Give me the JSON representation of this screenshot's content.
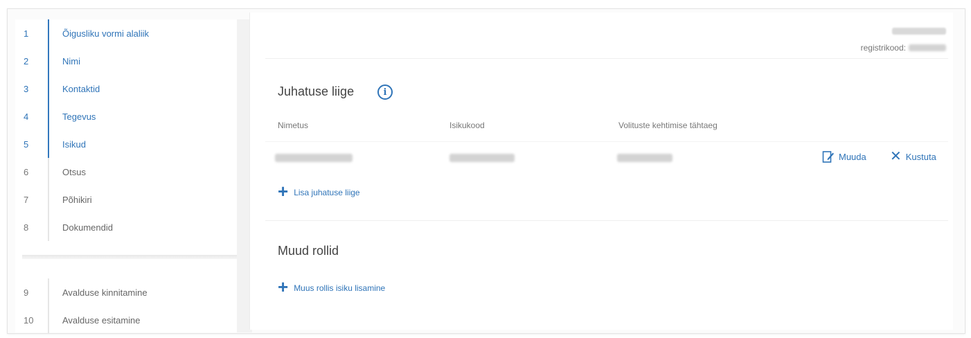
{
  "sidebar": {
    "steps": [
      {
        "num": "1",
        "label": "Õigusliku vormi alaliik",
        "done": true
      },
      {
        "num": "2",
        "label": "Nimi",
        "done": true
      },
      {
        "num": "3",
        "label": "Kontaktid",
        "done": true
      },
      {
        "num": "4",
        "label": "Tegevus",
        "done": true
      },
      {
        "num": "5",
        "label": "Isikud",
        "done": true
      },
      {
        "num": "6",
        "label": "Otsus",
        "done": false
      },
      {
        "num": "7",
        "label": "Põhikiri",
        "done": false
      },
      {
        "num": "8",
        "label": "Dokumendid",
        "done": false
      }
    ],
    "steps_after": [
      {
        "num": "9",
        "label": "Avalduse kinnitamine"
      },
      {
        "num": "10",
        "label": "Avalduse esitamine"
      }
    ]
  },
  "header": {
    "reg_label": "registrikood:"
  },
  "board": {
    "title": "Juhatuse liige",
    "info_icon": "info-icon",
    "columns": [
      "Nimetus",
      "Isikukood",
      "Volituste kehtimise tähtaeg"
    ],
    "edit_label": "Muuda",
    "delete_label": "Kustuta",
    "add_label": "Lisa juhatuse liige"
  },
  "other_roles": {
    "title": "Muud rollid",
    "add_label": "Muus rollis isiku lisamine"
  },
  "colors": {
    "accent": "#2f74b8",
    "text": "#444444",
    "muted": "#777777"
  }
}
